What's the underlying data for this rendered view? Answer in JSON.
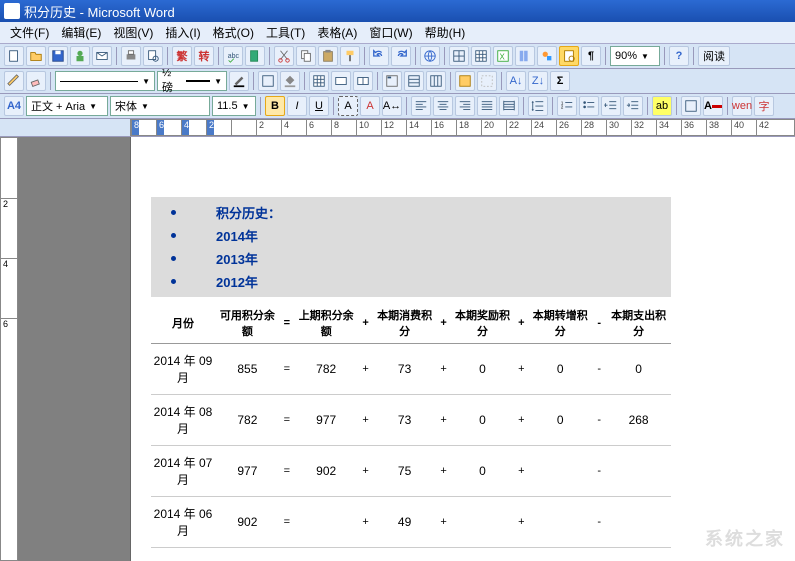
{
  "title": "积分历史 - Microsoft Word",
  "menu": {
    "file": "文件(F)",
    "edit": "编辑(E)",
    "view": "视图(V)",
    "insert": "插入(I)",
    "format": "格式(O)",
    "tools": "工具(T)",
    "table": "表格(A)",
    "window": "窗口(W)",
    "help": "帮助(H)"
  },
  "toolbar1": {
    "tradSimp": "繁",
    "tradSimpAlt": "转",
    "zoom": "90%",
    "readMode": "阅读"
  },
  "toolbar2": {
    "lineWeight": "½ 磅"
  },
  "toolbar3": {
    "styleLabel": "A4",
    "style": "正文 + Aria",
    "font": "宋体",
    "size": "11.5",
    "bold": "B",
    "italic": "I",
    "underline": "U",
    "strike": "A",
    "wen": "wen",
    "zi": "字"
  },
  "ruler": {
    "marks": [
      "8",
      "6",
      "4",
      "2",
      "",
      "2",
      "4",
      "6",
      "8",
      "10",
      "12",
      "14",
      "16",
      "18",
      "20",
      "22",
      "24",
      "26",
      "28",
      "30",
      "32",
      "34",
      "36",
      "38",
      "40",
      "42"
    ]
  },
  "vruler": {
    "marks": [
      "2",
      "4",
      "6"
    ]
  },
  "doc": {
    "heading": "积分历史：",
    "years": [
      "2014年",
      "2013年",
      "2012年"
    ],
    "headers": {
      "month": "月份",
      "avail": "可用积分余额",
      "prev": "上期积分余额",
      "consume": "本期消费积分",
      "reward": "本期奖励积分",
      "transfer": "本期转增积分",
      "expense": "本期支出积分"
    },
    "ops": {
      "eq": "=",
      "plus": "+",
      "minus": "-"
    },
    "rows": [
      {
        "month": "2014 年 09 月",
        "avail": "855",
        "prev": "782",
        "consume": "73",
        "reward": "0",
        "transfer": "0",
        "expense": "0"
      },
      {
        "month": "2014 年 08 月",
        "avail": "782",
        "prev": "977",
        "consume": "73",
        "reward": "0",
        "transfer": "0",
        "expense": "268"
      },
      {
        "month": "2014 年 07 月",
        "avail": "977",
        "prev": "902",
        "consume": "75",
        "reward": "0",
        "transfer": "",
        "expense": ""
      },
      {
        "month": "2014 年 06 月",
        "avail": "902",
        "prev": "",
        "consume": "49",
        "reward": "",
        "transfer": "",
        "expense": ""
      }
    ]
  },
  "watermark": "系统之家"
}
